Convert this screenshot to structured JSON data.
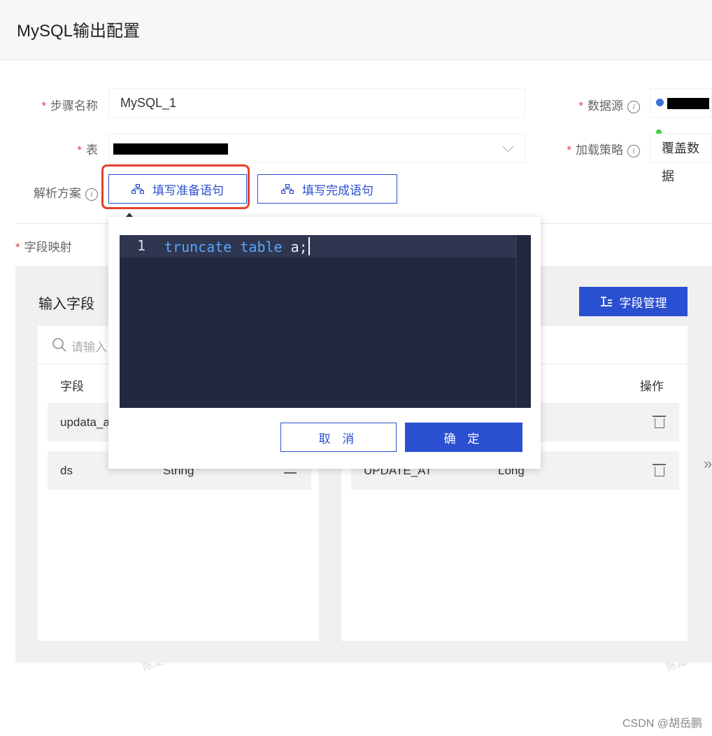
{
  "header": {
    "title": "MySQL输出配置"
  },
  "form": {
    "step_name": {
      "label": "步骤名称",
      "value": "MySQL_1"
    },
    "datasource": {
      "label": "数据源"
    },
    "table": {
      "label": "表"
    },
    "load_strategy": {
      "label": "加载策略",
      "value": "覆盖数据"
    },
    "parse_scheme": {
      "label": "解析方案"
    },
    "prepare_button": "填写准备语句",
    "finish_button": "填写完成语句",
    "field_mapping": {
      "label": "字段映射"
    }
  },
  "mapping": {
    "title": "输入字段",
    "manage_button": "字段管理",
    "search_placeholder": "请输入",
    "left": {
      "col_field": "字段",
      "rows": [
        {
          "name": "updata_a",
          "type": ""
        },
        {
          "name": "ds",
          "type": "String"
        }
      ]
    },
    "right": {
      "col_action": "操作",
      "rows": [
        {
          "name": "",
          "type": ""
        },
        {
          "name": "UPDATE_AT",
          "type": "Long"
        }
      ]
    }
  },
  "editor": {
    "line_number": "1",
    "tokens": [
      "truncate",
      "table",
      "a;"
    ]
  },
  "dialog": {
    "cancel": "取 消",
    "confirm": "确 定"
  },
  "watermark": "CSDN @胡岳鹏",
  "wm_text": "陈龙",
  "colors": {
    "primary": "#2b4fd1",
    "highlight": "#e5402c",
    "required": "#e23d3d",
    "editor_bg": "#222840"
  }
}
